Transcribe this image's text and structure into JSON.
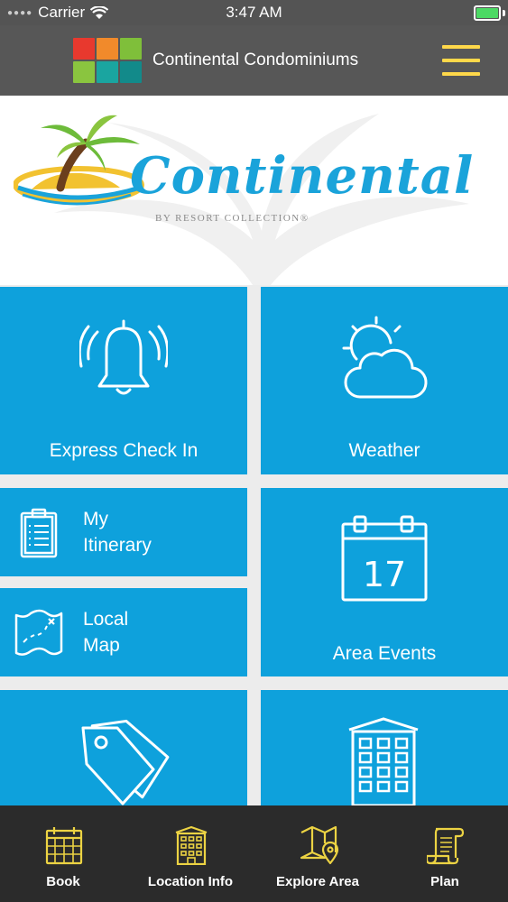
{
  "status_bar": {
    "carrier": "Carrier",
    "time": "3:47 AM"
  },
  "nav_bar": {
    "title": "Continental Condominiums",
    "logo_colors": [
      "#e8392e",
      "#f18a2b",
      "#7fbf3a",
      "#8ac53f",
      "#1aa5a0",
      "#128a8a"
    ],
    "menu_color": "#ffd84a"
  },
  "brand": {
    "name": "Continental",
    "subtitle": "BY RESORT COLLECTION®"
  },
  "tiles": {
    "express_check_in": "Express Check In",
    "weather": "Weather",
    "my_itinerary_line1": "My",
    "my_itinerary_line2": "Itinerary",
    "local_map_line1": "Local",
    "local_map_line2": "Map",
    "area_events": "Area Events",
    "calendar_day": "17"
  },
  "tab_bar": {
    "book": "Book",
    "location_info": "Location Info",
    "explore_area": "Explore Area",
    "plan": "Plan",
    "icon_color": "#ecd343"
  },
  "colors": {
    "tile_blue": "#0ea1dc",
    "brand_blue": "#1aa3da"
  }
}
